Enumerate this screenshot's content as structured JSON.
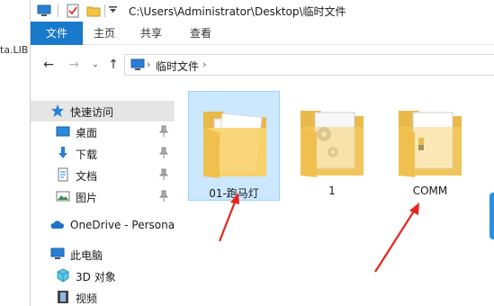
{
  "window": {
    "path": "C:\\Users\\Administrator\\Desktop\\临时文件"
  },
  "desktop": {
    "partial_label": "ta.LIB"
  },
  "ribbon": {
    "tabs": [
      "文件",
      "主页",
      "共享",
      "查看"
    ]
  },
  "address_bar": {
    "crumb": "临时文件"
  },
  "nav_pane": {
    "items": [
      {
        "label": "快速访问",
        "icon": "star-icon"
      },
      {
        "label": "桌面",
        "icon": "desktop-icon",
        "pinned": true
      },
      {
        "label": "下载",
        "icon": "download-icon",
        "pinned": true
      },
      {
        "label": "文档",
        "icon": "document-icon",
        "pinned": true
      },
      {
        "label": "图片",
        "icon": "picture-icon",
        "pinned": true
      },
      {
        "label": "OneDrive - Persona",
        "icon": "onedrive-icon"
      },
      {
        "label": "此电脑",
        "icon": "computer-icon"
      },
      {
        "label": "3D 对象",
        "icon": "3d-objects-icon"
      },
      {
        "label": "视频",
        "icon": "video-icon"
      }
    ]
  },
  "files": [
    {
      "name": "01-跑马灯",
      "selected": true
    },
    {
      "name": "1",
      "selected": false
    },
    {
      "name": "COMM",
      "selected": false
    }
  ],
  "colors": {
    "accent": "#1979ca",
    "selection": "#cce8ff",
    "arrow": "#e5261f"
  }
}
